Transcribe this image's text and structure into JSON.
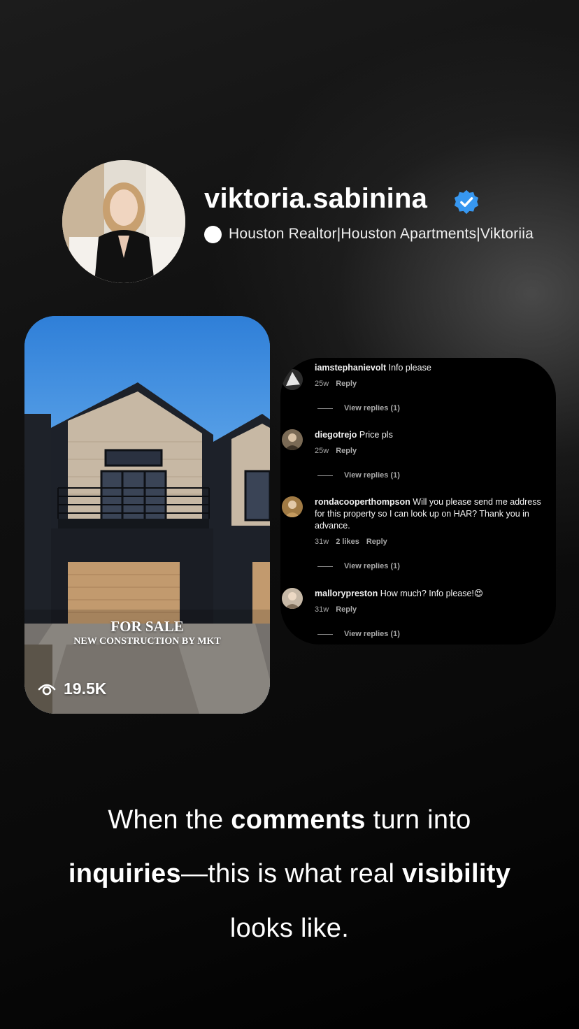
{
  "profile": {
    "username": "viktoria.sabinina",
    "bio": "Houston Realtor|Houston Apartments|Viktoriia"
  },
  "post": {
    "overlay_title": "FOR SALE",
    "overlay_subtitle": "NEW CONSTRUCTION BY MKT",
    "views": "19.5K"
  },
  "comments": [
    {
      "user": "iamstephanievolt",
      "text": "Info please",
      "age": "25w",
      "likes": "",
      "reply": "Reply",
      "view_replies": "View replies (1)"
    },
    {
      "user": "diegotrejo",
      "text": "Price pls",
      "age": "25w",
      "likes": "",
      "reply": "Reply",
      "view_replies": "View replies (1)"
    },
    {
      "user": "rondacooperthompson",
      "text": "Will you please send me address",
      "text2": "for this property so I can look up on HAR? Thank you in",
      "text3": "advance.",
      "age": "31w",
      "likes": "2 likes",
      "reply": "Reply",
      "view_replies": "View replies (1)"
    },
    {
      "user": "mallorypreston",
      "text": "How much? Info please!😍",
      "age": "31w",
      "likes": "",
      "reply": "Reply",
      "view_replies": "View replies (1)"
    }
  ],
  "caption": {
    "l1_a": "When the ",
    "l1_b": "comments",
    "l1_c": " turn into",
    "l2_a": "inquiries",
    "l2_b": "—this is what real ",
    "l2_c": "visibility",
    "l3": "looks like."
  }
}
